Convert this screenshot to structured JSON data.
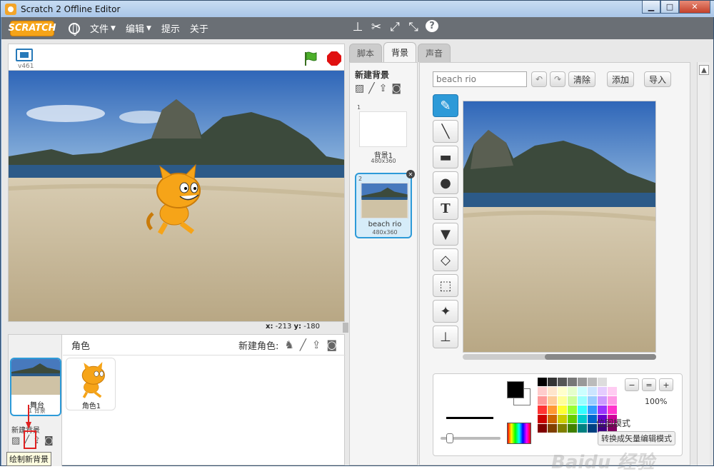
{
  "window": {
    "title": "Scratch 2 Offline Editor",
    "min": "▁",
    "max": "□",
    "close": "✕"
  },
  "menubar": {
    "logo": "SCRATCH",
    "items": [
      "文件",
      "编辑",
      "提示",
      "关于"
    ]
  },
  "stage": {
    "version": "v461",
    "coords": {
      "x_label": "x:",
      "x": "-213",
      "y_label": "y:",
      "y": "-180"
    }
  },
  "sprites": {
    "title": "角色",
    "new_sprite_label": "新建角色:",
    "items": [
      {
        "name": "角色1"
      }
    ]
  },
  "stage_panel": {
    "label": "舞台",
    "sub": "1 背景",
    "new_backdrop_label": "新建背景",
    "tooltip": "绘制新背景"
  },
  "tabs": [
    "脚本",
    "背景",
    "声音"
  ],
  "backdrops": {
    "title": "新建背景",
    "items": [
      {
        "num": "1",
        "name": "背景1",
        "size": "480x360",
        "selected": false
      },
      {
        "num": "2",
        "name": "beach rio",
        "size": "480x360",
        "selected": true
      }
    ]
  },
  "editor": {
    "name_placeholder": "beach rio",
    "clear_label": "清除",
    "add_label": "添加",
    "import_label": "导入",
    "zoom": "100%",
    "mode_label": "位图模式",
    "convert_label": "转换成矢量编辑模式"
  },
  "watermark": "Baidu 经验",
  "colors": {
    "accent": "#2d9ad8",
    "menubar": "#6a6f75",
    "logo": "#f6a418",
    "stop": "#e01010"
  },
  "palette": [
    "#000000",
    "#333333",
    "#555555",
    "#777777",
    "#999999",
    "#bbbbbb",
    "#dddddd",
    "#ffffff",
    "#ffcccc",
    "#ffe5cc",
    "#ffffcc",
    "#e5ffcc",
    "#ccffff",
    "#cce5ff",
    "#e5ccff",
    "#ffccf2",
    "#ff9999",
    "#ffcc99",
    "#ffff99",
    "#ccff99",
    "#99ffff",
    "#99ccff",
    "#cc99ff",
    "#ff99e5",
    "#ff3333",
    "#ff9933",
    "#ffff33",
    "#99ff33",
    "#33ffff",
    "#3399ff",
    "#9933ff",
    "#ff33cc",
    "#cc0000",
    "#cc6600",
    "#cccc00",
    "#66cc00",
    "#00cccc",
    "#0066cc",
    "#6600cc",
    "#cc0099",
    "#800000",
    "#804000",
    "#808000",
    "#408000",
    "#008080",
    "#004080",
    "#400080",
    "#800060"
  ]
}
